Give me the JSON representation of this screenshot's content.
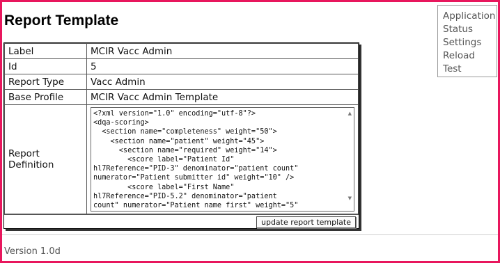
{
  "page": {
    "title": "Report Template"
  },
  "menu": {
    "items": [
      "Application",
      "Status",
      "Settings",
      "Reload",
      "Test"
    ]
  },
  "report": {
    "rows": [
      {
        "label": "Label",
        "value": "MCIR Vacc Admin"
      },
      {
        "label": "Id",
        "value": "5"
      },
      {
        "label": "Report Type",
        "value": "Vacc Admin"
      },
      {
        "label": "Base Profile",
        "value": "MCIR Vacc Admin Template"
      }
    ],
    "definition_label": "Report Definition",
    "definition_xml": "<?xml version=\"1.0\" encoding=\"utf-8\"?>\n<dqa-scoring>\n  <section name=\"completeness\" weight=\"50\">\n    <section name=\"patient\" weight=\"45\">\n      <section name=\"required\" weight=\"14\">\n        <score label=\"Patient Id\"\nhl7Reference=\"PID-3\" denominator=\"patient count\"\nnumerator=\"Patient submitter id\" weight=\"10\" />\n        <score label=\"First Name\"\nhl7Reference=\"PID-5.2\" denominator=\"patient\ncount\" numerator=\"Patient name first\" weight=\"5\"",
    "update_button": "update report template"
  },
  "footer": {
    "version": "Version 1.0d"
  },
  "colors": {
    "frame": "#e8175d"
  }
}
